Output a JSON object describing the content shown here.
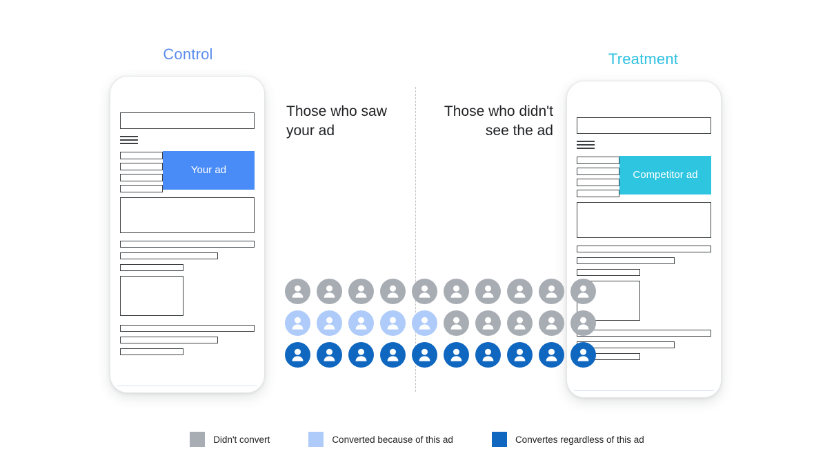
{
  "columns": {
    "control": {
      "title": "Control"
    },
    "treatment": {
      "title": "Treatment"
    }
  },
  "phones": {
    "control": {
      "ad_label": "Your ad",
      "ad_color": "#4a8cf7",
      "menu_icon": "hamburger-icon"
    },
    "treatment": {
      "ad_label": "Competitor ad",
      "ad_color": "#2ec5e0",
      "menu_icon": "hamburger-icon"
    }
  },
  "captions": {
    "left": "Those who saw your ad",
    "right": "Those who didn't see the ad"
  },
  "chart_data": {
    "type": "table",
    "title": "Ad conversion lift by exposure group",
    "categories": [
      "Those who saw your ad",
      "Those who didn't see the ad"
    ],
    "series": [
      {
        "name": "Didn't convert",
        "color": "#a8adb4",
        "values": [
          5,
          10
        ]
      },
      {
        "name": "Converted because of this ad",
        "color": "#aecbfa",
        "values": [
          5,
          0
        ]
      },
      {
        "name": "Convertes regardless of this ad",
        "color": "#1067c0",
        "values": [
          5,
          5
        ]
      }
    ],
    "unit": "people icons",
    "rows_per_group": 3,
    "icons_per_row": 5,
    "grid": {
      "left_group": [
        [
          "didnt-convert",
          "didnt-convert",
          "didnt-convert",
          "didnt-convert",
          "didnt-convert"
        ],
        [
          "converted-because",
          "converted-because",
          "converted-because",
          "converted-because",
          "converted-because"
        ],
        [
          "converted-regardless",
          "converted-regardless",
          "converted-regardless",
          "converted-regardless",
          "converted-regardless"
        ]
      ],
      "right_group": [
        [
          "didnt-convert",
          "didnt-convert",
          "didnt-convert",
          "didnt-convert",
          "didnt-convert"
        ],
        [
          "didnt-convert",
          "didnt-convert",
          "didnt-convert",
          "didnt-convert",
          "didnt-convert"
        ],
        [
          "converted-regardless",
          "converted-regardless",
          "converted-regardless",
          "converted-regardless",
          "converted-regardless"
        ]
      ]
    }
  },
  "legend": {
    "items": [
      {
        "label": "Didn't convert",
        "color": "#a8adb4"
      },
      {
        "label": "Converted because of this ad",
        "color": "#aecbfa"
      },
      {
        "label": "Convertes regardless of this ad",
        "color": "#1067c0"
      }
    ]
  },
  "colors": {
    "control_accent": "#5b8def",
    "treatment_accent": "#2ec0e0",
    "didnt_convert": "#a8adb4",
    "converted_because": "#aecbfa",
    "converted_regardless": "#1067c0",
    "wireframe_stroke": "#3c4043",
    "divider": "#bdc1c6"
  }
}
